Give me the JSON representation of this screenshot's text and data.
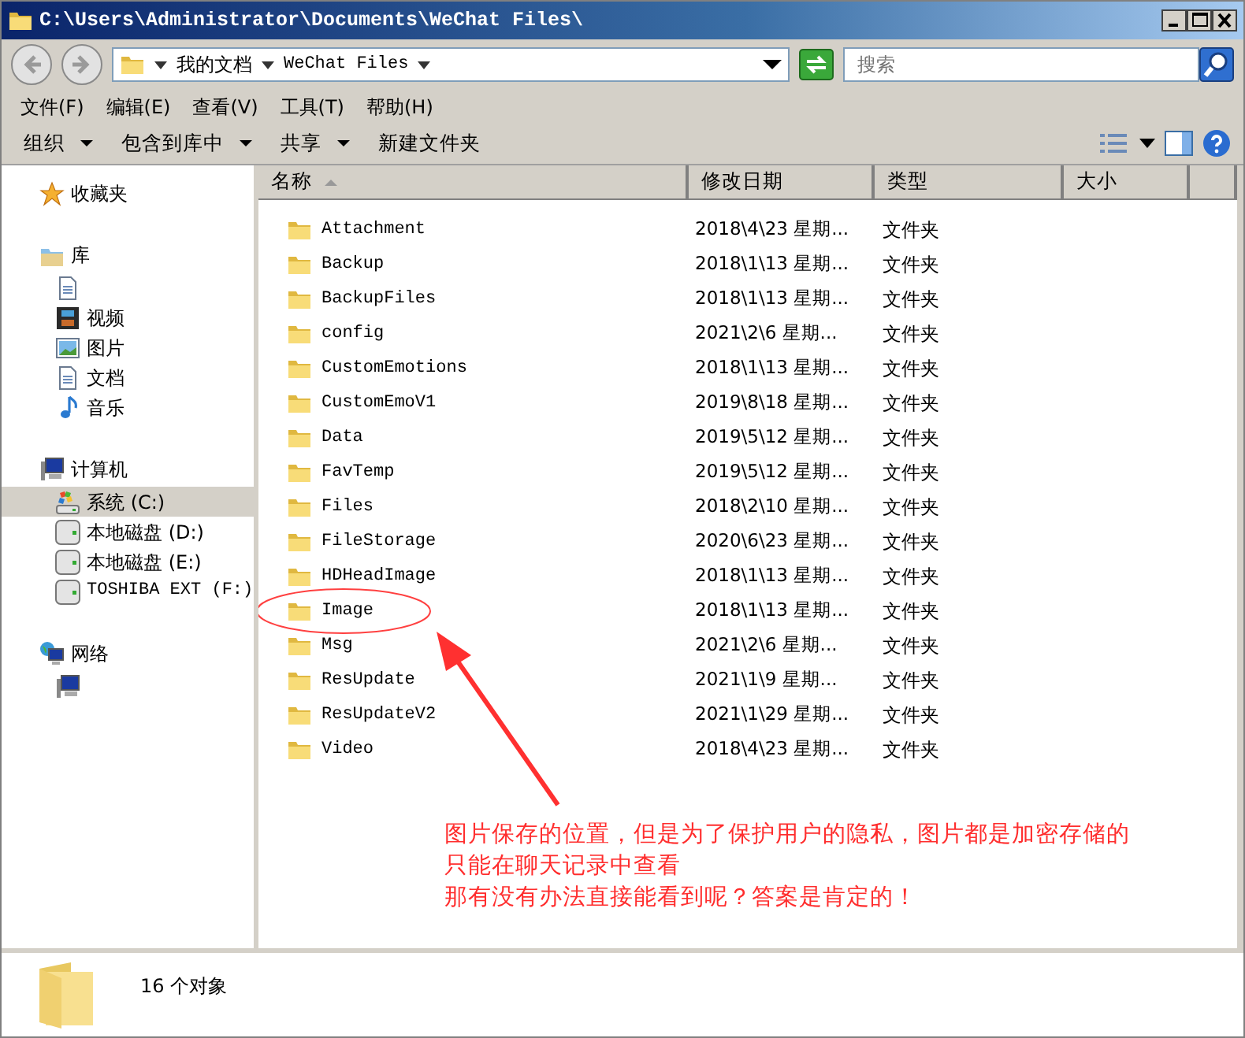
{
  "window": {
    "title": "C:\\Users\\Administrator\\Documents\\WeChat Files\\"
  },
  "address": {
    "crumbs": [
      "我的文档",
      "WeChat Files"
    ]
  },
  "search": {
    "placeholder": "搜索"
  },
  "menu": [
    "文件(F)",
    "编辑(E)",
    "查看(V)",
    "工具(T)",
    "帮助(H)"
  ],
  "toolbar": [
    {
      "label": "组织",
      "dropdown": true
    },
    {
      "label": "包含到库中",
      "dropdown": true
    },
    {
      "label": "共享",
      "dropdown": true
    },
    {
      "label": "新建文件夹",
      "dropdown": false
    }
  ],
  "sidebar": {
    "items": [
      {
        "kind": "favorites",
        "label": "收藏夹",
        "selected": false
      },
      {
        "kind": "library",
        "label": "库",
        "selected": false,
        "children": [
          {
            "kind": "documents",
            "selected": false
          },
          {
            "kind": "video",
            "label": "视频",
            "selected": false
          },
          {
            "kind": "pictures",
            "label": "图片",
            "selected": false
          },
          {
            "kind": "documents",
            "label": "文档",
            "selected": false
          },
          {
            "kind": "music",
            "label": "音乐",
            "selected": false
          }
        ]
      },
      {
        "kind": "computer",
        "label": "计算机",
        "selected": false,
        "children": [
          {
            "kind": "system-drive",
            "label": "系统 (C:)",
            "selected": true
          },
          {
            "kind": "drive",
            "label": "本地磁盘 (D:)",
            "selected": false
          },
          {
            "kind": "drive",
            "label": "本地磁盘 (E:)",
            "selected": false
          },
          {
            "kind": "drive",
            "label": "TOSHIBA EXT (F:)",
            "selected": false
          }
        ]
      },
      {
        "kind": "network",
        "label": "网络",
        "selected": false,
        "children": [
          {
            "kind": "computer",
            "selected": false
          }
        ]
      }
    ]
  },
  "table": {
    "columns": [
      {
        "label": "名称",
        "sorted": true
      },
      {
        "label": "修改日期",
        "sorted": false
      },
      {
        "label": "类型",
        "sorted": false
      },
      {
        "label": "大小",
        "sorted": false
      }
    ],
    "rows": [
      {
        "name": "Attachment",
        "date": "2018\\4\\23 星期...",
        "type": "文件夹"
      },
      {
        "name": "Backup",
        "date": "2018\\1\\13 星期...",
        "type": "文件夹"
      },
      {
        "name": "BackupFiles",
        "date": "2018\\1\\13 星期...",
        "type": "文件夹"
      },
      {
        "name": "config",
        "date": "2021\\2\\6 星期...",
        "type": "文件夹"
      },
      {
        "name": "CustomEmotions",
        "date": "2018\\1\\13 星期...",
        "type": "文件夹"
      },
      {
        "name": "CustomEmoV1",
        "date": "2019\\8\\18 星期...",
        "type": "文件夹"
      },
      {
        "name": "Data",
        "date": "2019\\5\\12 星期...",
        "type": "文件夹"
      },
      {
        "name": "FavTemp",
        "date": "2019\\5\\12 星期...",
        "type": "文件夹"
      },
      {
        "name": "Files",
        "date": "2018\\2\\10 星期...",
        "type": "文件夹"
      },
      {
        "name": "FileStorage",
        "date": "2020\\6\\23 星期...",
        "type": "文件夹"
      },
      {
        "name": "HDHeadImage",
        "date": "2018\\1\\13 星期...",
        "type": "文件夹"
      },
      {
        "name": "Image",
        "date": "2018\\1\\13 星期...",
        "type": "文件夹"
      },
      {
        "name": "Msg",
        "date": "2021\\2\\6 星期...",
        "type": "文件夹"
      },
      {
        "name": "ResUpdate",
        "date": "2021\\1\\9 星期...",
        "type": "文件夹"
      },
      {
        "name": "ResUpdateV2",
        "date": "2021\\1\\29 星期...",
        "type": "文件夹"
      },
      {
        "name": "Video",
        "date": "2018\\4\\23 星期...",
        "type": "文件夹"
      }
    ]
  },
  "annotation": {
    "lines": [
      "图片保存的位置，但是为了保护用户的隐私，图片都是加密存储的",
      "只能在聊天记录中查看",
      "那有没有办法直接能看到呢？答案是肯定的！"
    ]
  },
  "status_bar": {
    "count": "16 个对象"
  }
}
